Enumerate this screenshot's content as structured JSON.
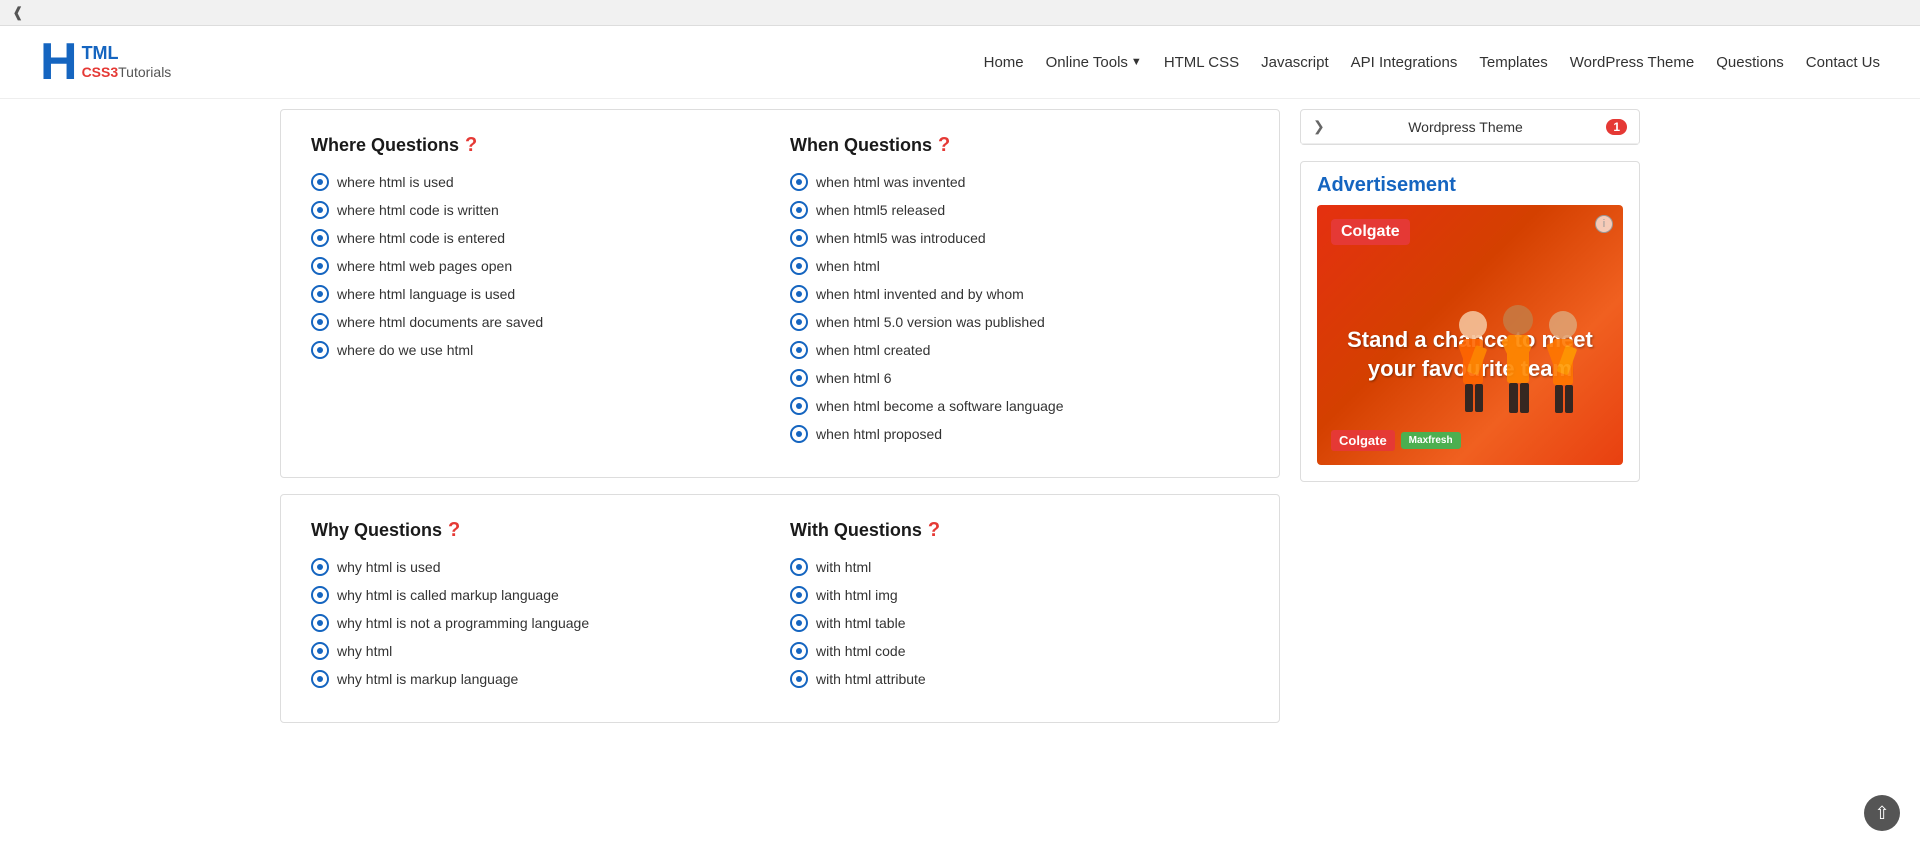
{
  "browser": {
    "tab_chevron": "❮"
  },
  "navbar": {
    "logo_h": "H",
    "logo_html": "TML",
    "logo_css3": "CSS3",
    "logo_tutorials": "Tutorials",
    "nav_items": [
      {
        "label": "Home",
        "key": "home"
      },
      {
        "label": "Online Tools",
        "key": "online-tools",
        "has_dropdown": true
      },
      {
        "label": "HTML CSS",
        "key": "html-css"
      },
      {
        "label": "Javascript",
        "key": "javascript"
      },
      {
        "label": "API Integrations",
        "key": "api-integrations"
      },
      {
        "label": "Templates",
        "key": "templates"
      },
      {
        "label": "WordPress Theme",
        "key": "wordpress-theme"
      },
      {
        "label": "Questions",
        "key": "questions"
      },
      {
        "label": "Contact Us",
        "key": "contact-us"
      }
    ]
  },
  "sidebar": {
    "wordpress_item": {
      "label": "Wordpress Theme",
      "badge": "1"
    },
    "advertisement_title": "Advertisement",
    "ad_colgate": "Colgate",
    "ad_info": "ℹ",
    "ad_text": "Stand a chance to meet your favourite team",
    "ad_colgate_brand": "Colgate",
    "ad_maxfresh": "Maxfresh"
  },
  "where_section": {
    "title": "Where Questions",
    "question_mark": "?",
    "items": [
      "where html is used",
      "where html code is written",
      "where html code is entered",
      "where html web pages open",
      "where html language is used",
      "where html documents are saved",
      "where do we use html"
    ]
  },
  "when_section": {
    "title": "When Questions",
    "question_mark": "?",
    "items": [
      "when html was invented",
      "when html5 released",
      "when html5 was introduced",
      "when html",
      "when html invented and by whom",
      "when html 5.0 version was published",
      "when html created",
      "when html 6",
      "when html become a software language",
      "when html proposed"
    ]
  },
  "why_section": {
    "title": "Why Questions",
    "question_mark": "?",
    "items": [
      "why html is used",
      "why html is called markup language",
      "why html is not a programming language",
      "why html",
      "why html is markup language"
    ]
  },
  "with_section": {
    "title": "With Questions",
    "question_mark": "?",
    "items": [
      "with html",
      "with html img",
      "with html table",
      "with html code",
      "with html attribute"
    ]
  }
}
